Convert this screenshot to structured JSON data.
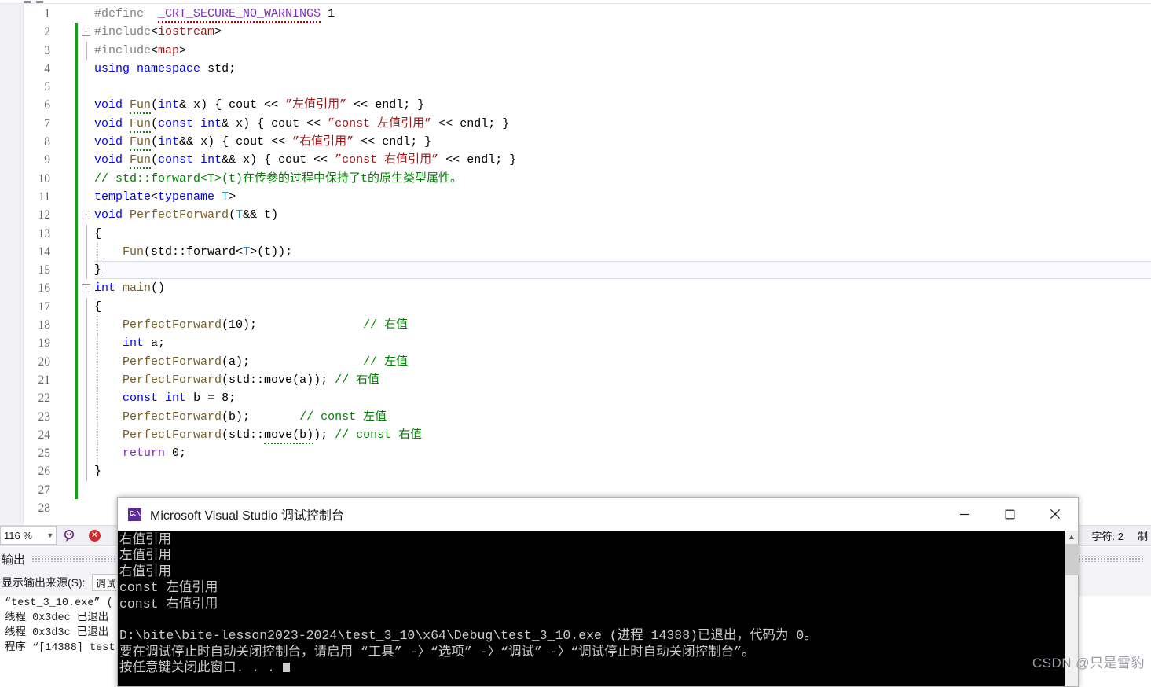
{
  "editor": {
    "zoom_level": "116 %",
    "lines": [
      {
        "n": "1",
        "html": "<span class=\"pp\">#define</span>&nbsp;&nbsp;<span class=\"macro squig-red\">_CRT_SECURE_NO_WARNINGS</span> <span class=\"plain\">1</span>",
        "bar": false,
        "fold": "",
        "guide": ""
      },
      {
        "n": "2",
        "html": "<span class=\"pp\">#include</span><span class=\"op\">&lt;</span><span class=\"hdr\">iostream</span><span class=\"op\">&gt;</span>",
        "bar": true,
        "fold": "-",
        "guide": ""
      },
      {
        "n": "3",
        "html": "<span class=\"pp\">#include</span><span class=\"op\">&lt;</span><span class=\"hdr\">map</span><span class=\"op\">&gt;</span>",
        "bar": true,
        "fold": "",
        "guide": "solid"
      },
      {
        "n": "4",
        "html": "<span class=\"kw\">using</span> <span class=\"kw\">namespace</span> <span class=\"plain\">std;</span>",
        "bar": true,
        "fold": "",
        "guide": ""
      },
      {
        "n": "5",
        "html": "",
        "bar": true,
        "fold": "",
        "guide": ""
      },
      {
        "n": "6",
        "html": "<span class=\"kw\">void</span> <span class=\"func squig\">Fun</span><span class=\"plain\">(</span><span class=\"kw\">int</span><span class=\"plain\">&amp; x) { cout </span><span class=\"op\">&lt;&lt;</span> <span class=\"str\">”左值引用”</span> <span class=\"op\">&lt;&lt;</span> <span class=\"plain\">endl; }</span>",
        "bar": true,
        "fold": "",
        "guide": ""
      },
      {
        "n": "7",
        "html": "<span class=\"kw\">void</span> <span class=\"func squig\">Fun</span><span class=\"plain\">(</span><span class=\"kw\">const</span> <span class=\"kw\">int</span><span class=\"plain\">&amp; x) { cout </span><span class=\"op\">&lt;&lt;</span> <span class=\"str\">”const 左值引用”</span> <span class=\"op\">&lt;&lt;</span> <span class=\"plain\">endl; }</span>",
        "bar": true,
        "fold": "",
        "guide": ""
      },
      {
        "n": "8",
        "html": "<span class=\"kw\">void</span> <span class=\"func squig\">Fun</span><span class=\"plain\">(</span><span class=\"kw\">int</span><span class=\"plain\">&amp;&amp; x) { cout </span><span class=\"op\">&lt;&lt;</span> <span class=\"str\">”右值引用”</span> <span class=\"op\">&lt;&lt;</span> <span class=\"plain\">endl; }</span>",
        "bar": true,
        "fold": "",
        "guide": ""
      },
      {
        "n": "9",
        "html": "<span class=\"kw\">void</span> <span class=\"func squig\">Fun</span><span class=\"plain\">(</span><span class=\"kw\">const</span> <span class=\"kw\">int</span><span class=\"plain\">&amp;&amp; x) { cout </span><span class=\"op\">&lt;&lt;</span> <span class=\"str\">”const 右值引用”</span> <span class=\"op\">&lt;&lt;</span> <span class=\"plain\">endl; }</span>",
        "bar": true,
        "fold": "",
        "guide": ""
      },
      {
        "n": "10",
        "html": "<span class=\"cmt\">// std::forward&lt;T&gt;(t)在传参的过程中保持了t的原生类型属性。</span>",
        "bar": true,
        "fold": "",
        "guide": ""
      },
      {
        "n": "11",
        "html": "<span class=\"kw\">template</span><span class=\"op\">&lt;</span><span class=\"kw\">typename</span> <span class=\"type\">T</span><span class=\"op\">&gt;</span>",
        "bar": true,
        "fold": "",
        "guide": ""
      },
      {
        "n": "12",
        "html": "<span class=\"kw\">void</span> <span class=\"func\">PerfectForward</span><span class=\"plain\">(</span><span class=\"type\">T</span><span class=\"plain\">&amp;&amp; t)</span>",
        "bar": true,
        "fold": "-",
        "guide": ""
      },
      {
        "n": "13",
        "html": "<span class=\"plain\">{</span>",
        "bar": true,
        "fold": "",
        "guide": "solid"
      },
      {
        "n": "14",
        "html": "&nbsp;&nbsp;&nbsp;&nbsp;<span class=\"func\">Fun</span><span class=\"plain\">(std::forward</span><span class=\"op\">&lt;</span><span class=\"type\">T</span><span class=\"op\">&gt;</span><span class=\"plain\">(t));</span>",
        "bar": true,
        "fold": "",
        "guide": "dotted2"
      },
      {
        "n": "15",
        "html": "<span class=\"plain\">}</span><span class=\"caret\"></span>",
        "bar": true,
        "fold": "",
        "guide": "solid",
        "highlight": true
      },
      {
        "n": "16",
        "html": "<span class=\"kw\">int</span> <span class=\"func\">main</span><span class=\"plain\">()</span>",
        "bar": true,
        "fold": "-",
        "guide": ""
      },
      {
        "n": "17",
        "html": "<span class=\"plain\">{</span>",
        "bar": true,
        "fold": "",
        "guide": "solid"
      },
      {
        "n": "18",
        "html": "&nbsp;&nbsp;&nbsp;&nbsp;<span class=\"func\">PerfectForward</span><span class=\"plain\">(10);</span>&nbsp;&nbsp;&nbsp;&nbsp;&nbsp;&nbsp;&nbsp;&nbsp;&nbsp;&nbsp;&nbsp;&nbsp;&nbsp;&nbsp;&nbsp;<span class=\"cmt\">// 右值</span>",
        "bar": true,
        "fold": "",
        "guide": "dotted2"
      },
      {
        "n": "19",
        "html": "&nbsp;&nbsp;&nbsp;&nbsp;<span class=\"kw\">int</span> <span class=\"plain\">a;</span>",
        "bar": true,
        "fold": "",
        "guide": "dotted2"
      },
      {
        "n": "20",
        "html": "&nbsp;&nbsp;&nbsp;&nbsp;<span class=\"func\">PerfectForward</span><span class=\"plain\">(a);</span>&nbsp;&nbsp;&nbsp;&nbsp;&nbsp;&nbsp;&nbsp;&nbsp;&nbsp;&nbsp;&nbsp;&nbsp;&nbsp;&nbsp;&nbsp;&nbsp;<span class=\"cmt\">// 左值</span>",
        "bar": true,
        "fold": "",
        "guide": "dotted2"
      },
      {
        "n": "21",
        "html": "&nbsp;&nbsp;&nbsp;&nbsp;<span class=\"func\">PerfectForward</span><span class=\"plain\">(std::move(a));</span> <span class=\"cmt\">// 右值</span>",
        "bar": true,
        "fold": "",
        "guide": "dotted2"
      },
      {
        "n": "22",
        "html": "&nbsp;&nbsp;&nbsp;&nbsp;<span class=\"kw\">const</span> <span class=\"kw\">int</span> <span class=\"plain\">b = 8;</span>",
        "bar": true,
        "fold": "",
        "guide": "dotted2"
      },
      {
        "n": "23",
        "html": "&nbsp;&nbsp;&nbsp;&nbsp;<span class=\"func\">PerfectForward</span><span class=\"plain\">(b);</span>&nbsp;&nbsp;&nbsp;&nbsp;&nbsp;&nbsp;&nbsp;<span class=\"cmt\">// const 左值</span>",
        "bar": true,
        "fold": "",
        "guide": "dotted2"
      },
      {
        "n": "24",
        "html": "&nbsp;&nbsp;&nbsp;&nbsp;<span class=\"func\">PerfectForward</span><span class=\"plain\">(std::<span class=\"squig\">move(b)</span>);</span> <span class=\"cmt\">// const 右值</span>",
        "bar": true,
        "fold": "",
        "guide": "dotted2"
      },
      {
        "n": "25",
        "html": "&nbsp;&nbsp;&nbsp;&nbsp;<span class=\"kw2\">return</span> <span class=\"plain\">0;</span>",
        "bar": true,
        "fold": "",
        "guide": "dotted2"
      },
      {
        "n": "26",
        "html": "<span class=\"plain\">}</span>",
        "bar": true,
        "fold": "",
        "guide": "solid"
      },
      {
        "n": "27",
        "html": "",
        "bar": true,
        "fold": "",
        "guide": ""
      },
      {
        "n": "28",
        "html": "",
        "bar": false,
        "fold": "",
        "guide": ""
      }
    ]
  },
  "statusbar": {
    "zoom": "116 %",
    "char_label": "字符: 2",
    "tab_label": "制"
  },
  "output": {
    "title": "输出",
    "source_label": "显示输出来源(S):",
    "source_value": "调试",
    "lines": [
      "“test_3_10.exe” (",
      "线程 0x3dec 已退出",
      "线程 0x3d3c 已退出",
      "程序 “[14388] test"
    ]
  },
  "console": {
    "title": "Microsoft Visual Studio 调试控制台",
    "app_icon_text": "C:\\",
    "minimize_label": "最小化",
    "maximize_label": "最大化",
    "close_label": "关闭",
    "lines": [
      "右值引用",
      "左值引用",
      "右值引用",
      "const 左值引用",
      "const 右值引用",
      "",
      "D:\\bite\\bite-lesson2023-2024\\test_3_10\\x64\\Debug\\test_3_10.exe (进程 14388)已退出，代码为 0。",
      "要在调试停止时自动关闭控制台，请启用 “工具” -〉“选项” -〉“调试” -〉“调试停止时自动关闭控制台”。",
      "按任意键关闭此窗口. . ."
    ]
  },
  "watermark": {
    "text": "CSDN @只是雪豹"
  }
}
